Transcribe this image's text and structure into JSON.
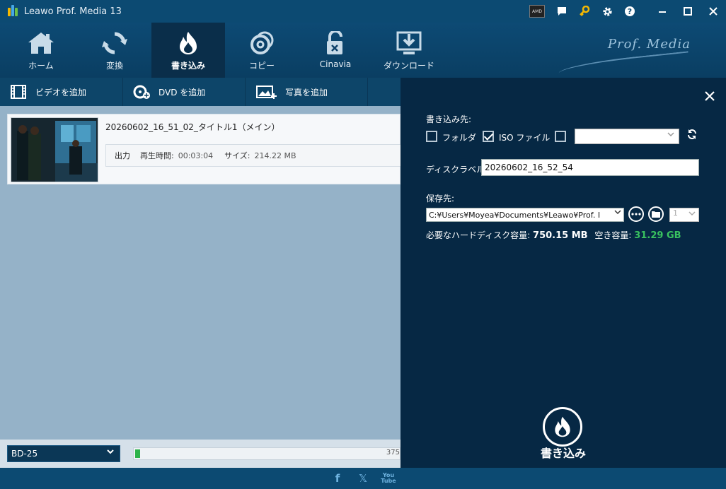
{
  "app": {
    "title": "Leawo Prof. Media 13",
    "logo_colors": [
      "#f5b800",
      "#48a9e6",
      "#6cc04a"
    ]
  },
  "titlebar": {
    "icons": [
      "amd-badge-icon",
      "feedback-icon",
      "key-icon",
      "gear-icon",
      "help-icon"
    ],
    "amd_badge_text": "AMD",
    "window_controls": [
      "minimize-icon",
      "maximize-icon",
      "close-icon"
    ]
  },
  "nav": {
    "tabs": [
      {
        "label": "ホーム",
        "icon": "home-icon"
      },
      {
        "label": "変換",
        "icon": "convert-icon"
      },
      {
        "label": "書き込み",
        "icon": "burn-icon",
        "active": true
      },
      {
        "label": "コピー",
        "icon": "copy-disc-icon"
      },
      {
        "label": "Cinavia",
        "icon": "cinavia-lock-icon"
      },
      {
        "label": "ダウンロード",
        "icon": "download-icon"
      }
    ],
    "brand": "Prof. Media"
  },
  "toolbar": {
    "add_video": "ビデオを追加",
    "add_dvd": "DVD を追加",
    "add_photo": "写真を追加"
  },
  "file": {
    "name": "20260602_16_51_02_タイトル1（メイン）",
    "output_label": "出力",
    "duration_label": "再生時間:",
    "duration": "00:03:04",
    "size_label": "サイズ:",
    "size": "214.22 MB"
  },
  "bottom": {
    "disc_type": "BD-25",
    "progress_fraction": 0.02,
    "capacity_text": "375"
  },
  "footer": {
    "social": [
      "f",
      "𝕏",
      "You Tube"
    ]
  },
  "panel": {
    "burn_to_label": "書き込み先:",
    "folder_label": "フォルダ",
    "folder_checked": false,
    "iso_label": "ISO ファイル",
    "iso_checked": true,
    "drive_checked": false,
    "drive_value": "",
    "disc_label_label": "ディスクラベル:",
    "disc_label_value": "20260602_16_52_54",
    "save_to_label": "保存先:",
    "save_path": "C:¥Users¥Moyea¥Documents¥Leawo¥Prof. I",
    "copies_value": "1",
    "required_space_label": "必要なハードディスク容量:",
    "required_space": "750.15 MB",
    "free_space_label": "空き容量:",
    "free_space": "31.29 GB",
    "burn_button_label": "書き込み",
    "free_space_color": "#39c25f"
  }
}
